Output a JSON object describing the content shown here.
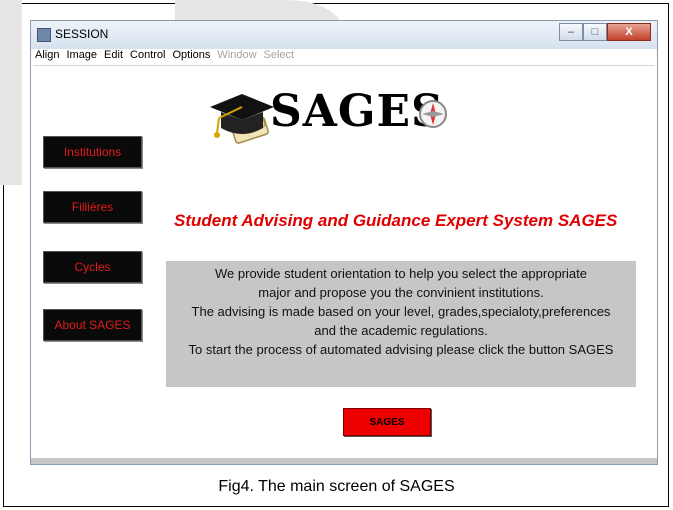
{
  "window": {
    "title": "SESSION",
    "controls": {
      "minimize": "–",
      "maximize": "□",
      "close": "X"
    }
  },
  "menu": {
    "items": [
      {
        "label": "Align",
        "enabled": true
      },
      {
        "label": "Image",
        "enabled": true
      },
      {
        "label": "Edit",
        "enabled": true
      },
      {
        "label": "Control",
        "enabled": true
      },
      {
        "label": "Options",
        "enabled": true
      },
      {
        "label": "Window",
        "enabled": false
      },
      {
        "label": "Select",
        "enabled": false
      }
    ]
  },
  "logo": {
    "text": "SAGES"
  },
  "sidebar": {
    "buttons": [
      {
        "label": "Institutions"
      },
      {
        "label": "Filliéres"
      },
      {
        "label": "Cycles"
      },
      {
        "label": "About SAGES"
      }
    ]
  },
  "main": {
    "heading": "Student Advising and Guidance Expert System SAGES",
    "description_lines": [
      "We provide student orientation to help you select the appropriate",
      "major and propose you the convinient institutions.",
      "The advising is made based on your level, grades,specialoty,preferences",
      "and the academic regulations.",
      "To start the process of automated advising please click the button SAGES"
    ],
    "start_button": "SAGES"
  },
  "caption": "Fig4. The main screen of SAGES",
  "colors": {
    "accent_red": "#e00000",
    "button_black": "#0a0a0a",
    "panel_gray": "#c6c6c6"
  }
}
